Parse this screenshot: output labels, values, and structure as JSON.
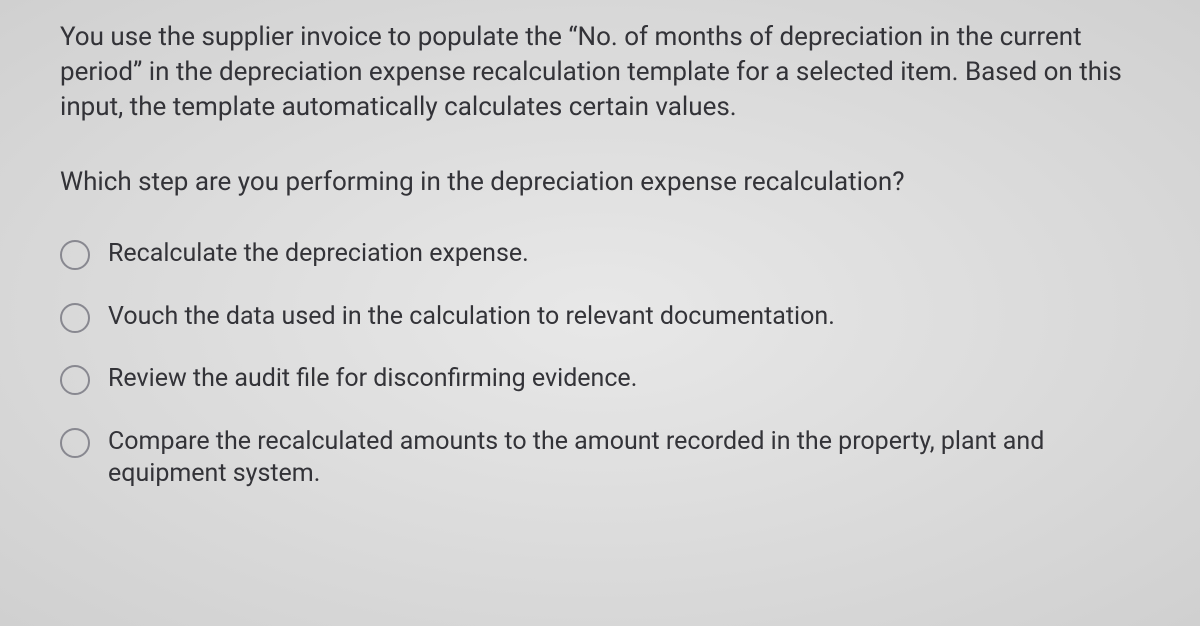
{
  "question": {
    "context": "You use the supplier invoice to populate the “No. of months of depreciation in the current period” in the depreciation expense recalculation template for a selected item. Based on this input, the template automatically calculates certain values.",
    "prompt": "Which step are you performing in the depreciation expense recalculation?"
  },
  "options": [
    {
      "label": "Recalculate the depreciation expense."
    },
    {
      "label": "Vouch the data used in the calculation to relevant documentation."
    },
    {
      "label": "Review the audit file for disconfirming evidence."
    },
    {
      "label": "Compare the recalculated amounts to the amount recorded in the property, plant and equipment system."
    }
  ]
}
